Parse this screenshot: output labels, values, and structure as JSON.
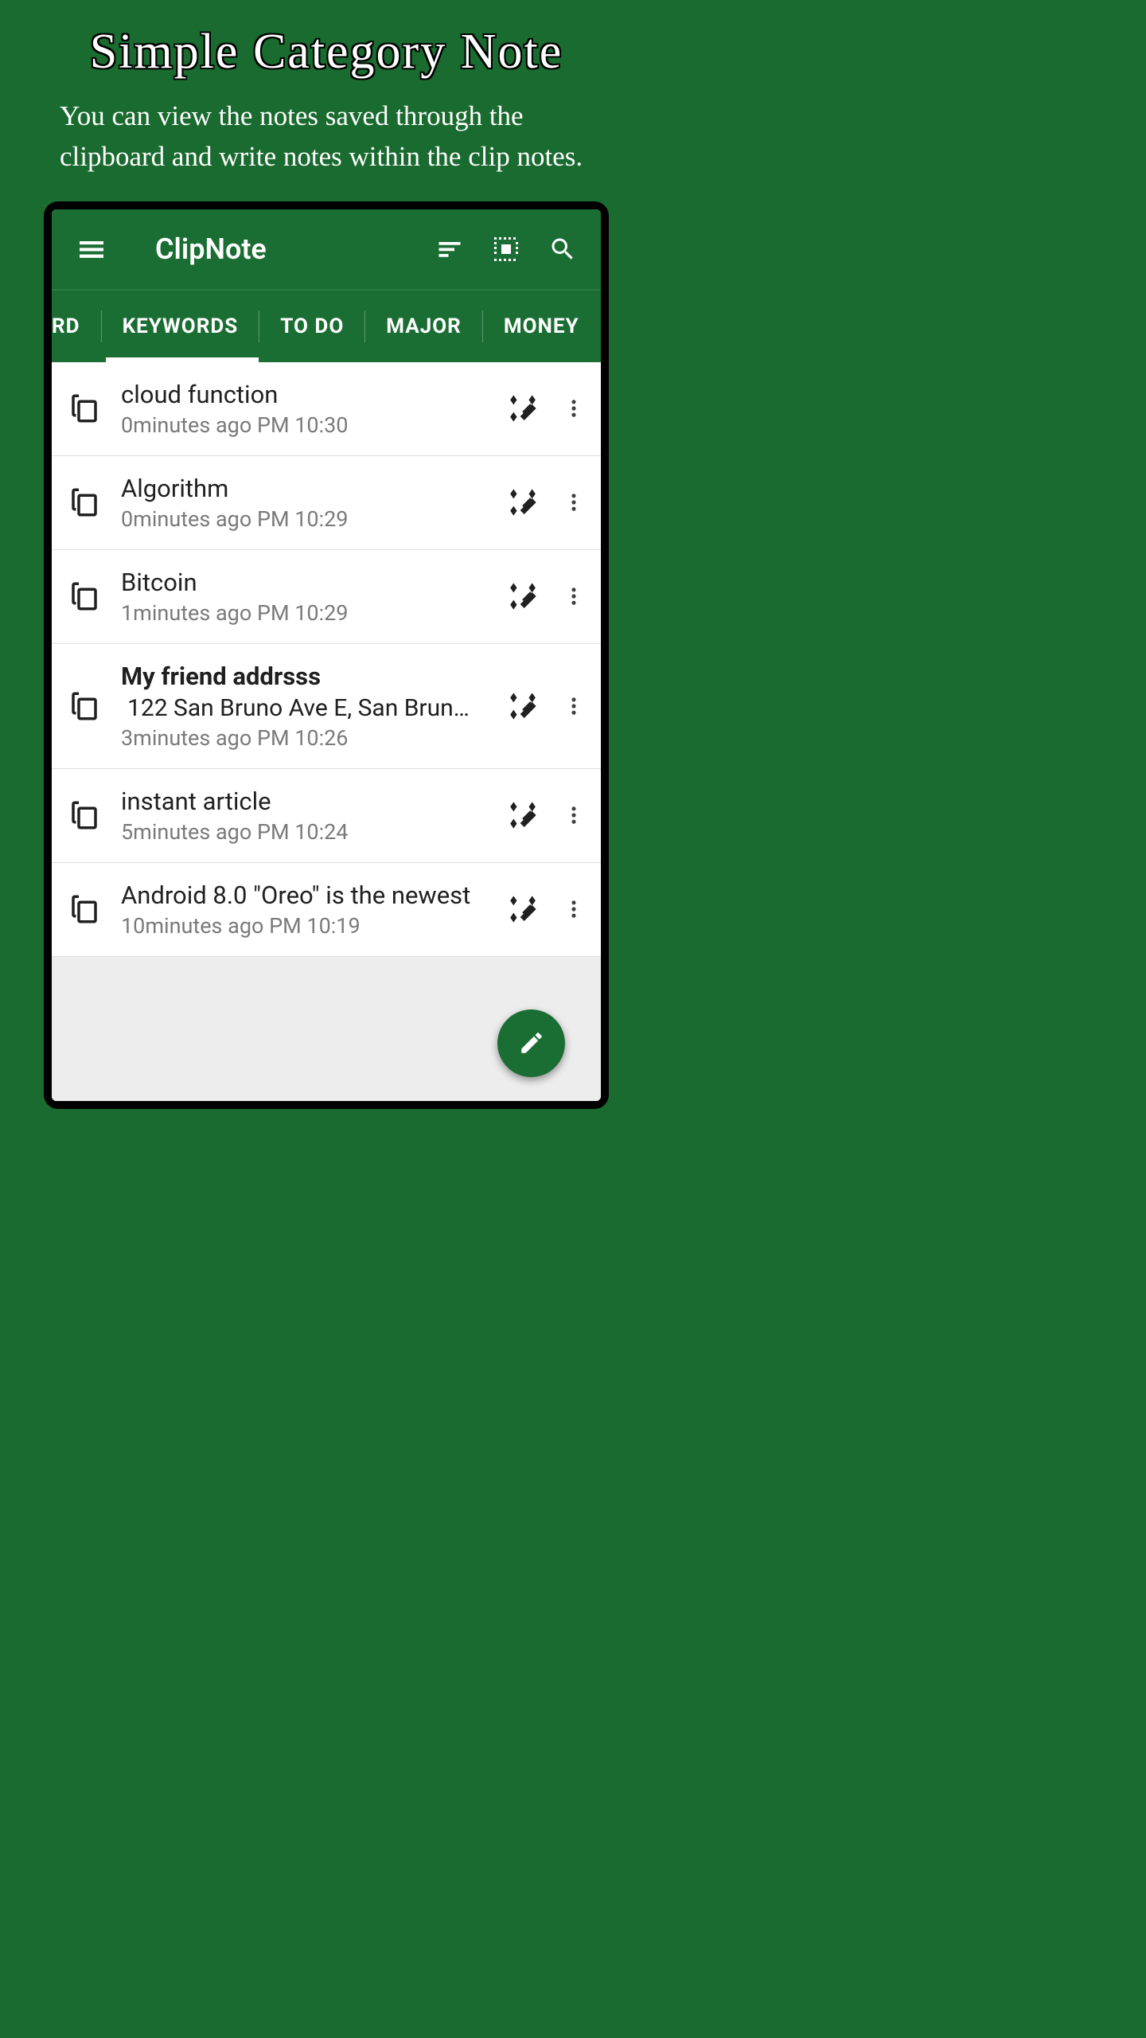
{
  "promo": {
    "title": "Simple Category Note",
    "subtitle": "You can view the notes saved through the clipboard and write notes within the clip notes."
  },
  "app": {
    "title": "ClipNote"
  },
  "tabs": {
    "partial": "RD",
    "items": [
      "KEYWORDS",
      "TO DO",
      "MAJOR",
      "MONEY"
    ],
    "active_index": 0
  },
  "notes": [
    {
      "title": "cloud function",
      "subtitle": "",
      "time": "0minutes ago PM 10:30",
      "bold": false
    },
    {
      "title": "Algorithm",
      "subtitle": "",
      "time": "0minutes ago PM 10:29",
      "bold": false
    },
    {
      "title": "Bitcoin",
      "subtitle": "",
      "time": "1minutes ago PM 10:29",
      "bold": false
    },
    {
      "title": "My friend addrsss",
      "subtitle": "122 San Bruno Ave E, San Brun…",
      "time": "3minutes ago PM 10:26",
      "bold": true
    },
    {
      "title": "instant article",
      "subtitle": "",
      "time": "5minutes ago PM 10:24",
      "bold": false
    },
    {
      "title": "Android 8.0 \"Oreo\" is the newest",
      "subtitle": "",
      "time": "10minutes ago PM 10:19",
      "bold": false
    }
  ],
  "colors": {
    "brand": "#1b6e33",
    "bg": "#1a6b2f"
  }
}
